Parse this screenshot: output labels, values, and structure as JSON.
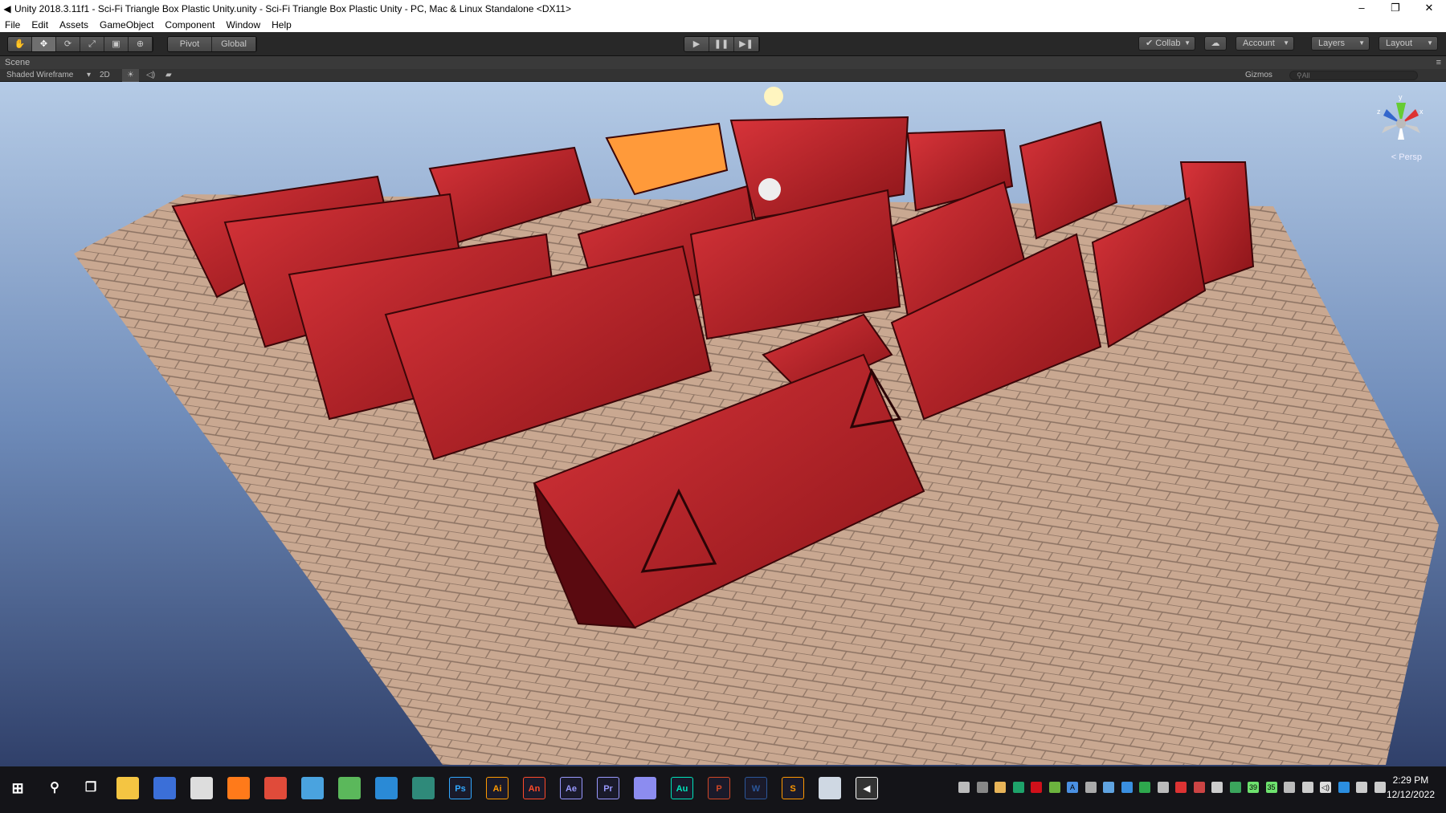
{
  "window": {
    "title": "Unity 2018.3.11f1 - Sci-Fi Triangle Box Plastic Unity.unity - Sci-Fi Triangle Box Plastic Unity - PC, Mac & Linux Standalone <DX11>",
    "minimize": "–",
    "restore": "❐",
    "close": "✕"
  },
  "menu": [
    "File",
    "Edit",
    "Assets",
    "GameObject",
    "Component",
    "Window",
    "Help"
  ],
  "toolbar": {
    "tools": [
      "✋",
      "✥",
      "⟳",
      "⤢",
      "▣",
      "⊕"
    ],
    "pivot": "Pivot",
    "global": "Global",
    "play": "▶",
    "pause": "❚❚",
    "step": "▶❚",
    "collab": "Collab",
    "cloud": "☁",
    "account": "Account",
    "layers": "Layers",
    "layout": "Layout"
  },
  "scene": {
    "tab": "Scene",
    "draw_mode": "Shaded Wireframe",
    "mode_2d": "2D",
    "lighting": "☀",
    "audio": "◁)",
    "effects": "▰",
    "gizmos": "Gizmos",
    "search_placeholder": "All",
    "persp": "Persp",
    "axes": {
      "x": "x",
      "y": "y",
      "z": "z"
    }
  },
  "taskbar": {
    "apps": [
      {
        "name": "file-explorer",
        "label": "",
        "color": "#f4c542"
      },
      {
        "name": "store",
        "label": "",
        "color": "#3b6fd8"
      },
      {
        "name": "paint",
        "label": "",
        "color": "#ddd"
      },
      {
        "name": "firefox",
        "label": "",
        "color": "#ff7a1a"
      },
      {
        "name": "chrome",
        "label": "",
        "color": "#e04b3a"
      },
      {
        "name": "magnifier",
        "label": "",
        "color": "#4aa3df"
      },
      {
        "name": "globe",
        "label": "",
        "color": "#5bb85b"
      },
      {
        "name": "earth",
        "label": "",
        "color": "#2a8ad6"
      },
      {
        "name": "dreamweaver",
        "label": "",
        "color": "#2f8a7a"
      },
      {
        "name": "photoshop",
        "label": "Ps",
        "color": "#31a8ff"
      },
      {
        "name": "illustrator",
        "label": "Ai",
        "color": "#ff9a00"
      },
      {
        "name": "animate",
        "label": "An",
        "color": "#ff4a2a"
      },
      {
        "name": "after-effects",
        "label": "Ae",
        "color": "#9999ff"
      },
      {
        "name": "premiere",
        "label": "Pr",
        "color": "#9999ff"
      },
      {
        "name": "media-encoder",
        "label": "",
        "color": "#8c8cf0"
      },
      {
        "name": "audition",
        "label": "Au",
        "color": "#00e4bb"
      },
      {
        "name": "powerpoint",
        "label": "P",
        "color": "#d24726"
      },
      {
        "name": "word",
        "label": "W",
        "color": "#2b579a"
      },
      {
        "name": "sublime",
        "label": "S",
        "color": "#ff9800"
      },
      {
        "name": "notepad",
        "label": "",
        "color": "#cfd8e3"
      },
      {
        "name": "unity",
        "label": "◀",
        "color": "#ffffff"
      }
    ],
    "tray": [
      {
        "name": "usb",
        "label": "",
        "color": "#bbb"
      },
      {
        "name": "network-h",
        "label": "",
        "color": "#888"
      },
      {
        "name": "weather",
        "label": "",
        "color": "#e7b458"
      },
      {
        "name": "shield",
        "label": "",
        "color": "#1ea36a"
      },
      {
        "name": "adobe",
        "label": "",
        "color": "#d0101a"
      },
      {
        "name": "nvidia",
        "label": "",
        "color": "#6cb33e"
      },
      {
        "name": "translate",
        "label": "A",
        "color": "#4a90e2"
      },
      {
        "name": "bluetooth-dev",
        "label": "",
        "color": "#aaa"
      },
      {
        "name": "calc",
        "label": "",
        "color": "#5fa3e0"
      },
      {
        "name": "dots",
        "label": "",
        "color": "#3a8fe0"
      },
      {
        "name": "location",
        "label": "",
        "color": "#2ea84d"
      },
      {
        "name": "tablet",
        "label": "",
        "color": "#bbb"
      },
      {
        "name": "acrobat",
        "label": "",
        "color": "#d33"
      },
      {
        "name": "ccleaner",
        "label": "",
        "color": "#c44"
      },
      {
        "name": "wifi",
        "label": "",
        "color": "#ccc"
      },
      {
        "name": "idm",
        "label": "",
        "color": "#3ba55c"
      },
      {
        "name": "temp-1",
        "label": "39",
        "color": "#6ee26e"
      },
      {
        "name": "temp-2",
        "label": "35",
        "color": "#6ee26e"
      },
      {
        "name": "security",
        "label": "",
        "color": "#bbb"
      },
      {
        "name": "eject",
        "label": "",
        "color": "#ccc"
      },
      {
        "name": "volume",
        "label": "◁)",
        "color": "#ddd"
      },
      {
        "name": "onedrive",
        "label": "",
        "color": "#2b8ee0"
      },
      {
        "name": "power",
        "label": "",
        "color": "#ccc"
      },
      {
        "name": "notifications",
        "label": "",
        "color": "#ccc"
      }
    ],
    "time": "2:29 PM",
    "date": "12/12/2022"
  }
}
